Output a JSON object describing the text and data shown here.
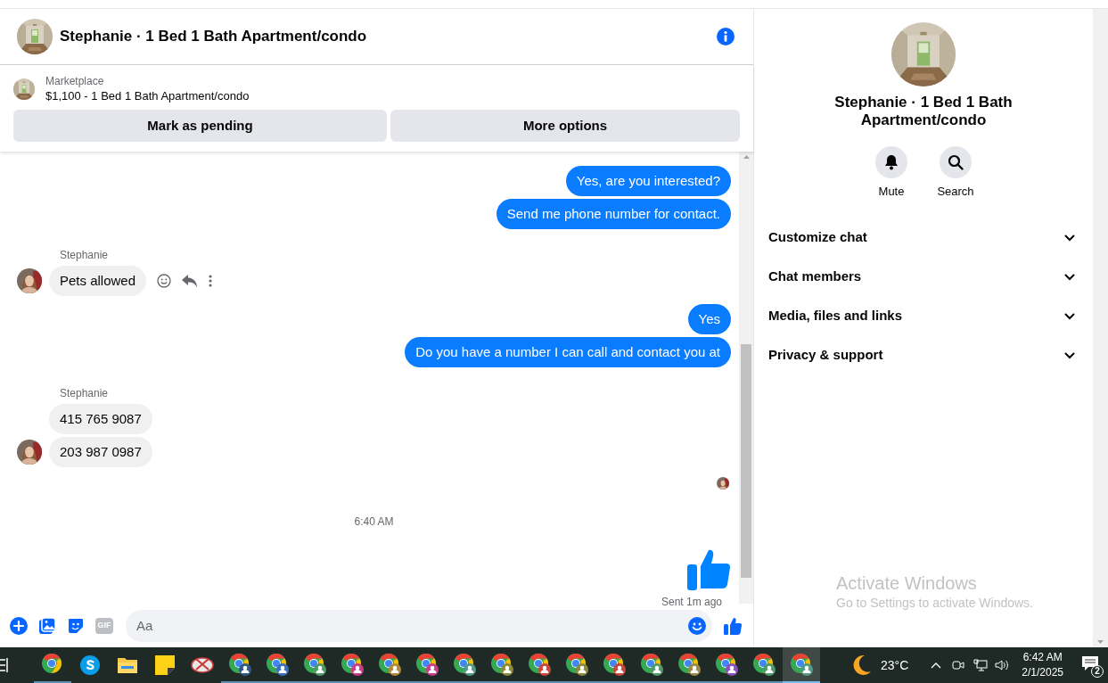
{
  "header": {
    "title": "Stephanie · 1 Bed 1 Bath Apartment/condo"
  },
  "listing": {
    "source": "Marketplace",
    "summary": "$1,100 - 1 Bed 1 Bath Apartment/condo",
    "buttons": [
      "Mark as pending",
      "More options"
    ]
  },
  "messages": [
    {
      "kind": "outgoing",
      "text": "Yes, are you interested?"
    },
    {
      "kind": "outgoing",
      "text": "Send me phone number for contact."
    },
    {
      "kind": "sender",
      "text": "Stephanie"
    },
    {
      "kind": "incoming",
      "text": "Pets allowed",
      "avatar": true,
      "actions": true
    },
    {
      "kind": "outgoing",
      "text": "Yes"
    },
    {
      "kind": "outgoing",
      "text": "Do you have a number I can call and contact you at"
    },
    {
      "kind": "sender",
      "text": "Stephanie"
    },
    {
      "kind": "incoming",
      "text": "415 765 9087",
      "avatar": false,
      "actions": false
    },
    {
      "kind": "incoming",
      "text": "203 987 0987",
      "avatar": true,
      "actions": false
    },
    {
      "kind": "seen"
    },
    {
      "kind": "time",
      "text": "6:40 AM"
    },
    {
      "kind": "like"
    },
    {
      "kind": "status",
      "text": "Sent 1m ago"
    }
  ],
  "composer": {
    "gif_label": "GIF",
    "placeholder": "Aa"
  },
  "details": {
    "title": "Stephanie · 1 Bed 1 Bath Apartment/condo",
    "actions": [
      {
        "kind": "mute",
        "label": "Mute"
      },
      {
        "kind": "search",
        "label": "Search"
      }
    ],
    "sections": [
      {
        "label": "Customize chat",
        "expanded": false
      },
      {
        "label": "Chat members",
        "expanded": false
      },
      {
        "label": "Media, files and links",
        "expanded": false
      },
      {
        "label": "Privacy & support",
        "expanded": false
      }
    ]
  },
  "activation_notice": {
    "title": "Activate Windows",
    "text": "Go to Settings to activate Windows."
  },
  "taskbar": {
    "temperature": "23°C",
    "time": "6:42 AM",
    "date": "2/1/2025",
    "notification_count": "2"
  }
}
